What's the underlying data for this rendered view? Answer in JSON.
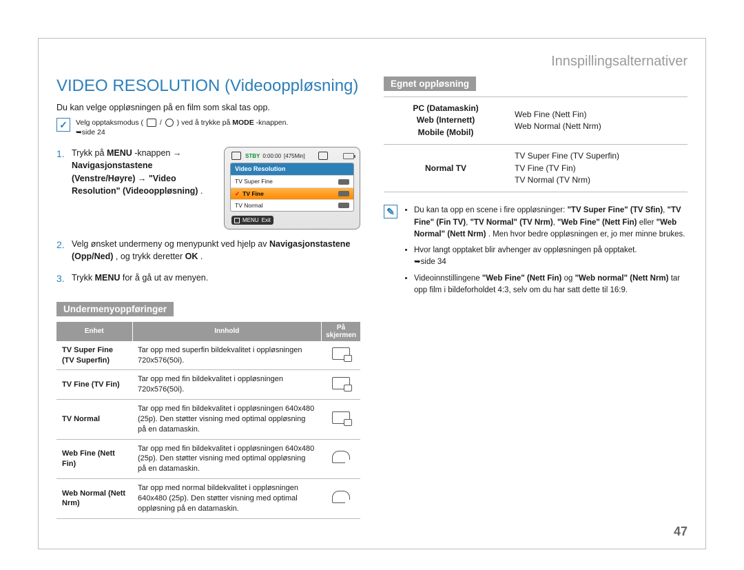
{
  "header": "Innspillingsalternativer",
  "main_title": "VIDEO RESOLUTION (Videooppløsning)",
  "intro": "Du kan velge oppløsningen på en film som skal tas opp.",
  "mode_note": {
    "prefix": "Velg opptaksmodus (",
    "sep": " / ",
    "suffix": ") ved å trykke på ",
    "btn": "MODE",
    "after": "-knappen.",
    "ref": "➥side 24"
  },
  "steps": {
    "s1": {
      "a": "Trykk på ",
      "menu": "MENU",
      "b": "-knappen → ",
      "nav": "Navigasjonstastene (Venstre/Høyre)",
      "c": " → ",
      "vr": "\"Video Resolution\" (Videooppløsning)",
      "d": "."
    },
    "s2": {
      "a": "Velg ønsket undermeny og menypunkt ved hjelp av ",
      "nav": "Navigasjonstastene (Opp/Ned)",
      "b": ", og trykk deretter ",
      "ok": "OK",
      "c": "."
    },
    "s3": {
      "a": "Trykk ",
      "menu": "MENU",
      "b": " for å gå ut av menyen."
    }
  },
  "lcd": {
    "stby": "STBY",
    "time": "0:00:00",
    "remain": "[475Min]",
    "panel_title": "Video Resolution",
    "items": [
      "TV Super Fine",
      "TV Fine",
      "TV Normal"
    ],
    "selected_index": 1,
    "exit_menu": "MENU",
    "exit_label": "Exit"
  },
  "sub_bar": "Undermenyoppføringer",
  "sub_headers": {
    "unit": "Enhet",
    "content": "Innhold",
    "screen": "På skjermen"
  },
  "sub_rows": [
    {
      "name": "TV Super Fine (TV Superfin)",
      "desc": "Tar opp med superfin bildekvalitet i oppløsningen 720x576(50i)."
    },
    {
      "name": "TV Fine (TV Fin)",
      "desc": "Tar opp med fin bildekvalitet i oppløsningen 720x576(50i)."
    },
    {
      "name": "TV Normal",
      "desc": "Tar opp med fin bildekvalitet i oppløsningen 640x480 (25p). Den støtter visning med optimal oppløsning på en datamaskin."
    },
    {
      "name": "Web Fine (Nett Fin)",
      "desc": "Tar opp med fin bildekvalitet i oppløsningen 640x480 (25p). Den støtter visning med optimal oppløsning på en datamaskin."
    },
    {
      "name": "Web Normal (Nett Nrm)",
      "desc": "Tar opp med normal bildekvalitet i oppløsningen 640x480 (25p). Den støtter visning med optimal oppløsning på en datamaskin."
    }
  ],
  "fit_bar": "Egnet oppløsning",
  "fit_rows": [
    {
      "cat": "PC (Datamaskin)\nWeb (Internett)\nMobile (Mobil)",
      "val": "Web Fine (Nett Fin)\nWeb Normal (Nett Nrm)"
    },
    {
      "cat": "Normal TV",
      "val": "TV Super Fine (TV Superfin)\nTV Fine (TV Fin)\nTV Normal (TV Nrm)"
    }
  ],
  "info_bullets": [
    {
      "a": "Du kan ta opp en scene i fire oppløsninger: ",
      "b1": "\"TV Super Fine\" (TV Sfin)",
      "mid1": ", ",
      "b2": "\"TV Fine\" (Fin TV)",
      "mid2": ", ",
      "b3": "\"TV Normal\" (TV Nrm)",
      "mid3": ", ",
      "b4": "\"Web Fine\" (Nett Fin)",
      "mid4": " eller ",
      "b5": "\"Web Normal\" (Nett Nrm)",
      "c": ". Men hvor bedre oppløsningen er, jo mer minne brukes."
    },
    {
      "a": "Hvor langt opptaket blir avhenger av oppløsningen på opptaket. ",
      "ref": "➥side 34"
    },
    {
      "a": "Videoinnstillingene ",
      "b1": "\"Web Fine\" (Nett Fin)",
      "mid1": " og ",
      "b2": "\"Web normal\" (Nett Nrm)",
      "c": " tar opp film i bildeforholdet 4:3, selv om du har satt dette til 16:9."
    }
  ],
  "page_number": "47"
}
